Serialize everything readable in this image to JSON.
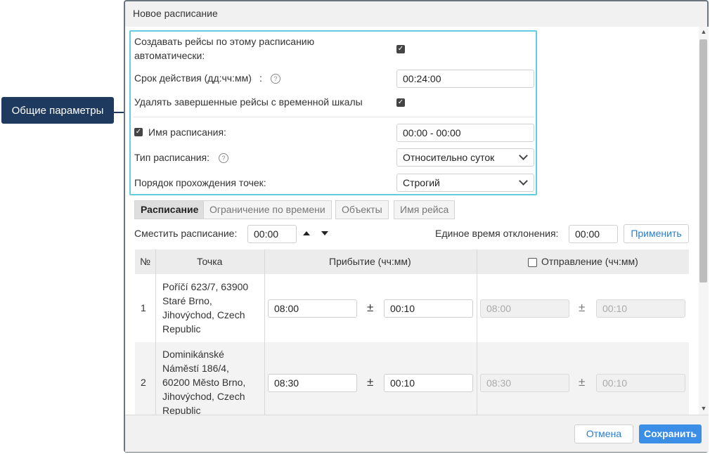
{
  "callout": "Общие параметры",
  "dialog": {
    "title": "Новое расписание"
  },
  "params": {
    "auto_create_label_line1": "Создавать рейсы по этому расписанию",
    "auto_create_label_line2": "автоматически:",
    "auto_create_checked": true,
    "validity_label": "Срок действия (дд:чч:мм)",
    "validity_colon": ":",
    "validity_value": "00:24:00",
    "delete_finished_label": "Удалять завершенные рейсы с временной шкалы",
    "delete_finished_checked": true,
    "name_label": "Имя расписания:",
    "name_checked": true,
    "name_value": "00:00 - 00:00",
    "type_label": "Тип расписания:",
    "type_value": "Относительно суток",
    "order_label": "Порядок прохождения точек:",
    "order_value": "Строгий"
  },
  "tabs": [
    {
      "label": "Расписание",
      "active": true
    },
    {
      "label": "Ограничение по времени",
      "active": false
    },
    {
      "label": "Объекты",
      "active": false
    },
    {
      "label": "Имя рейса",
      "active": false
    }
  ],
  "shift": {
    "label": "Сместить расписание:",
    "value": "00:00"
  },
  "deviation": {
    "label": "Единое время отклонения:",
    "value": "00:00",
    "apply_label": "Применить"
  },
  "table": {
    "headers": {
      "num": "№",
      "point": "Точка",
      "arrival": "Прибытие (чч:мм)",
      "departure": "Отправление (чч:мм)"
    },
    "departure_checked": false,
    "rows": [
      {
        "num": "1",
        "address_lines": [
          "Poříčí 623/7, 63900",
          "Staré Brno,",
          "Jihovýchod, Czech",
          "Republic"
        ],
        "arrival": "08:00",
        "arrival_dev": "00:10",
        "departure": "08:00",
        "departure_dev": "00:10"
      },
      {
        "num": "2",
        "address_lines": [
          "Dominikánské",
          "Náměstí 186/4,",
          "60200 Město Brno,",
          "Jihovýchod, Czech",
          "Republic"
        ],
        "arrival": "08:30",
        "arrival_dev": "00:10",
        "departure": "08:30",
        "departure_dev": "00:10"
      }
    ],
    "plus_minus": "±"
  },
  "footer": {
    "cancel_label": "Отмена",
    "save_label": "Сохранить"
  },
  "colors": {
    "callout_bg": "#1e3a5f",
    "highlight_border": "#63cde0",
    "primary": "#3a8ee6"
  }
}
